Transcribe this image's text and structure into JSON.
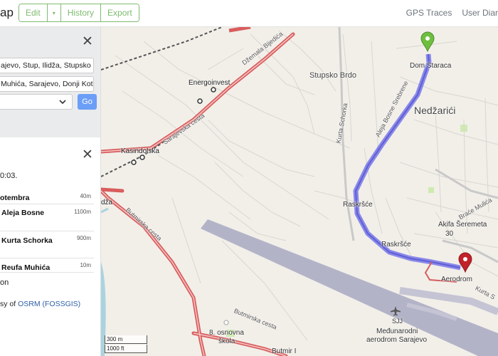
{
  "header": {
    "logo_text": "ap",
    "edit_label": "Edit",
    "edit_caret": "▾",
    "history_label": "History",
    "export_label": "Export",
    "gps_traces_label": "GPS Traces",
    "user_diaries_label": "User Diar"
  },
  "directions": {
    "close_symbol": "✕",
    "from_value": "ajevo, Stup, Ilidža, Stupsko B",
    "to_value": "Muhića, Sarajevo, Donji Kotor",
    "engine_value": "",
    "go_label": "Go"
  },
  "route": {
    "summary": "0:03.",
    "steps": [
      {
        "name": "otembra",
        "distance": "40m"
      },
      {
        "name": "Aleja Bosne",
        "distance": "1100m"
      },
      {
        "name": "Kurta Schorka",
        "distance": "900m"
      },
      {
        "name": "Reufa Muhića",
        "distance": "10m"
      }
    ],
    "final_text": "on",
    "credit_prefix": "sy of ",
    "credit_link": "OSRM (FOSSGIS)"
  },
  "map": {
    "labels": {
      "energoinvest": "Energoinvest",
      "kasindolska": "Kasindolska",
      "stupsko_brdo": "Stupsko Brdo",
      "nedzarici": "Nedžarići",
      "dom_staraca": "Dom Staraca",
      "raskrsce_1": "Raskršće",
      "raskrsce_2": "Raskršće",
      "aerodrom": "Aerodrom",
      "akifa": "Akifa Šeremeta",
      "akifa_num": "30",
      "sjj": "SJJ",
      "airport_1": "Međunarodni",
      "airport_2": "aerodrom Sarajevo",
      "osnovna_1": "8. osnovna",
      "osnovna_2": "škola",
      "butmir": "Butmir I",
      "dza": "dža",
      "brace": "Braće Mulića"
    },
    "streets": {
      "dzemala": "Džemala Bijedića",
      "sarajevska": "Sarajevska cesta",
      "kurta": "Kurta Schorka",
      "aleja": "Aleja Bosne Srebrene",
      "butmirska_1": "Butmirska cesta",
      "butmirska_2": "Butmirska cesta",
      "kurta_2": "Kurta S"
    },
    "scale_m": "300 m",
    "scale_ft": "1000 ft",
    "colors": {
      "route": "#6f6fe8",
      "start_marker": "#6fbf3f",
      "end_marker": "#c2222a",
      "main_road": "#d95d5d",
      "runway": "#b3b3c8"
    }
  }
}
